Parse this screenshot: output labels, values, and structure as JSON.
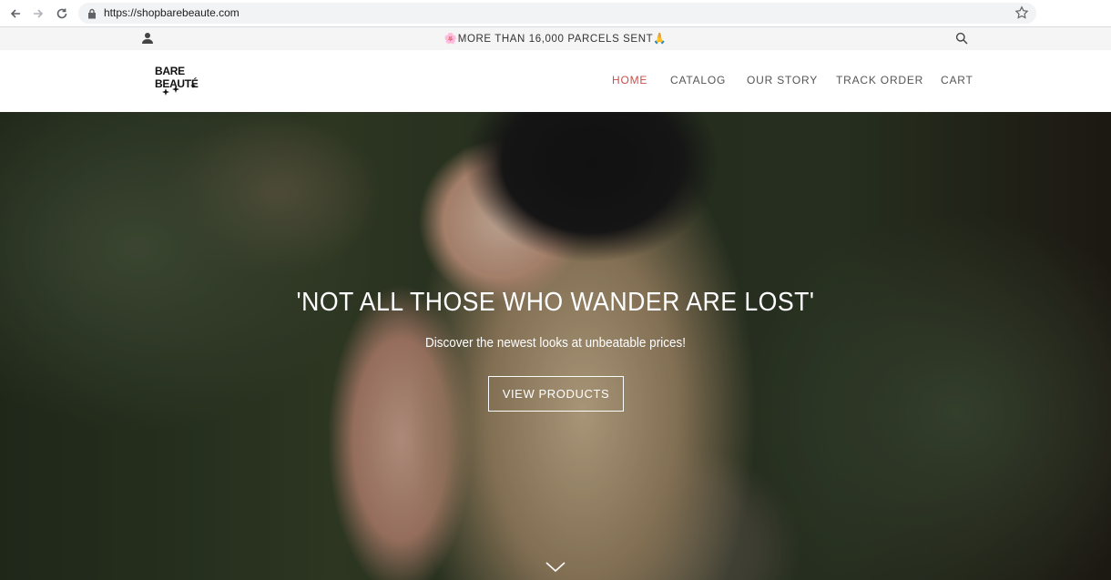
{
  "browser": {
    "url": "https://shopbarebeaute.com"
  },
  "announcement": {
    "text": "MORE THAN 16,000 PARCELS SENT",
    "lead_emoji": "🌸",
    "trail_emoji": "🙏"
  },
  "header": {
    "logo_text": "BARE BEAUTÉ",
    "nav": [
      {
        "label": "HOME",
        "active": true
      },
      {
        "label": "CATALOG",
        "active": false
      },
      {
        "label": "OUR STORY",
        "active": false
      },
      {
        "label": "TRACK ORDER",
        "active": false
      },
      {
        "label": "CART",
        "active": false
      }
    ]
  },
  "hero": {
    "title": "'NOT ALL THOSE WHO WANDER ARE LOST'",
    "subtitle": "Discover the newest looks at unbeatable prices!",
    "button_label": "VIEW PRODUCTS"
  },
  "colors": {
    "accent": "#c8504b",
    "nav_text": "#555555",
    "announcement_bg": "#f5f5f5"
  },
  "icons": [
    "back-icon",
    "forward-icon",
    "reload-icon",
    "lock-icon",
    "star-icon",
    "user-icon",
    "search-icon",
    "chevron-down-icon"
  ]
}
